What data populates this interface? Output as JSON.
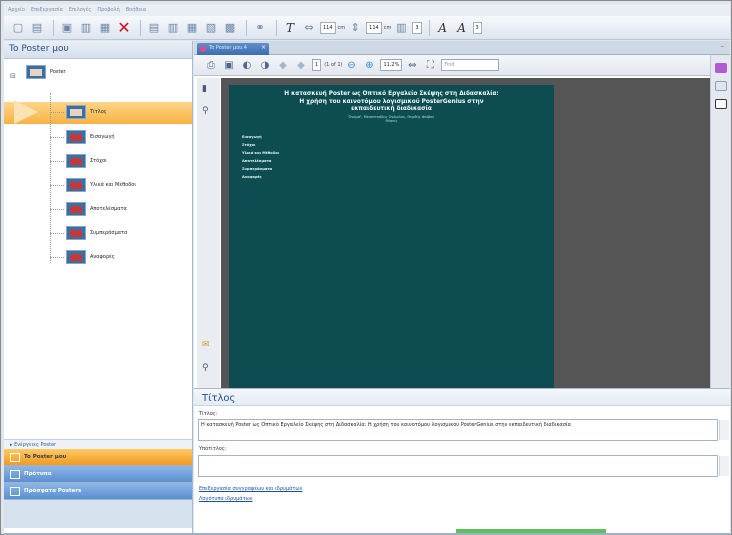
{
  "menubar": {
    "items": [
      "Αρχείο",
      "Επεξεργασία",
      "Επιλογές",
      "Προβολή",
      "Βοήθεια"
    ]
  },
  "toolbar": {
    "width_value": "114",
    "width_unit": "cm",
    "height_value": "114",
    "height_unit": "cm",
    "columns_value": "3",
    "font_size_value": "3",
    "decrease_font_label": "A",
    "increase_font_label": "A"
  },
  "left_panel": {
    "title": "To Poster μου",
    "tree": {
      "root_label": "Poster",
      "nodes": [
        {
          "label": "Τίτλος",
          "selected": true
        },
        {
          "label": "Εισαγωγή"
        },
        {
          "label": "Στόχοι"
        },
        {
          "label": "Υλικά και Μέθοδοι"
        },
        {
          "label": "Αποτελέσματα"
        },
        {
          "label": "Συμπεράσματα"
        },
        {
          "label": "Αναφορές"
        }
      ]
    },
    "actions_label": "▸ Ενέργειες Poster",
    "nav": [
      {
        "label": "To Poster μου",
        "active": true
      },
      {
        "label": "Πρότυπα",
        "active": false
      },
      {
        "label": "Πρόσφατα Posters",
        "active": false
      }
    ]
  },
  "document_tab": {
    "label": "To Poster μου.4"
  },
  "pdf_toolbar": {
    "page_value": "1",
    "page_of": "(1 of 1)",
    "zoom_value": "11,2%",
    "find_placeholder": "Find"
  },
  "poster_preview": {
    "title_line1": "Η κατασκευή Poster ως Οπτικό Εργαλείο Σκέψης στη Διδασκαλία:",
    "title_line2": "Η χρήση του καινοτόμου λογισμικού PosterGenius στην",
    "title_line3": "εκπαιδευτική διαδικασία",
    "authors": "Όνομα¹, Μεσοτεκόδης Ονόμιλος, Θεμθής Φαίβος",
    "affiliation": "Θέσεις",
    "sections": [
      "Εισαγωγή",
      "Στόχοι",
      "Υλικά και Μέθοδοι",
      "Αποτελέσματα",
      "Συμπεράσματα",
      "Αναφορές"
    ]
  },
  "properties": {
    "section_title": "Τίτλος",
    "title_label": "Τίτλος:",
    "title_value": "Η κατασκευή Poster ως Οπτικό Εργαλείο Σκέψης στη Διδασκαλία: Η χρήση του καινοτόμου λογισμικού PosterGenius στην εκπαιδευτική διαδικασία",
    "subtitle_label": "Υπότιτλος:",
    "subtitle_value": "",
    "link_authors": "Επεξεργασία συγγραφέων και ιδρυμάτων",
    "link_logos": "Λογότυπα ιδρυμάτων"
  },
  "colors": {
    "accent_orange": "#f7b342",
    "nav_blue": "#5b8fd0",
    "poster_bg": "#0d4d52",
    "title_blue": "#1f4d8c"
  }
}
